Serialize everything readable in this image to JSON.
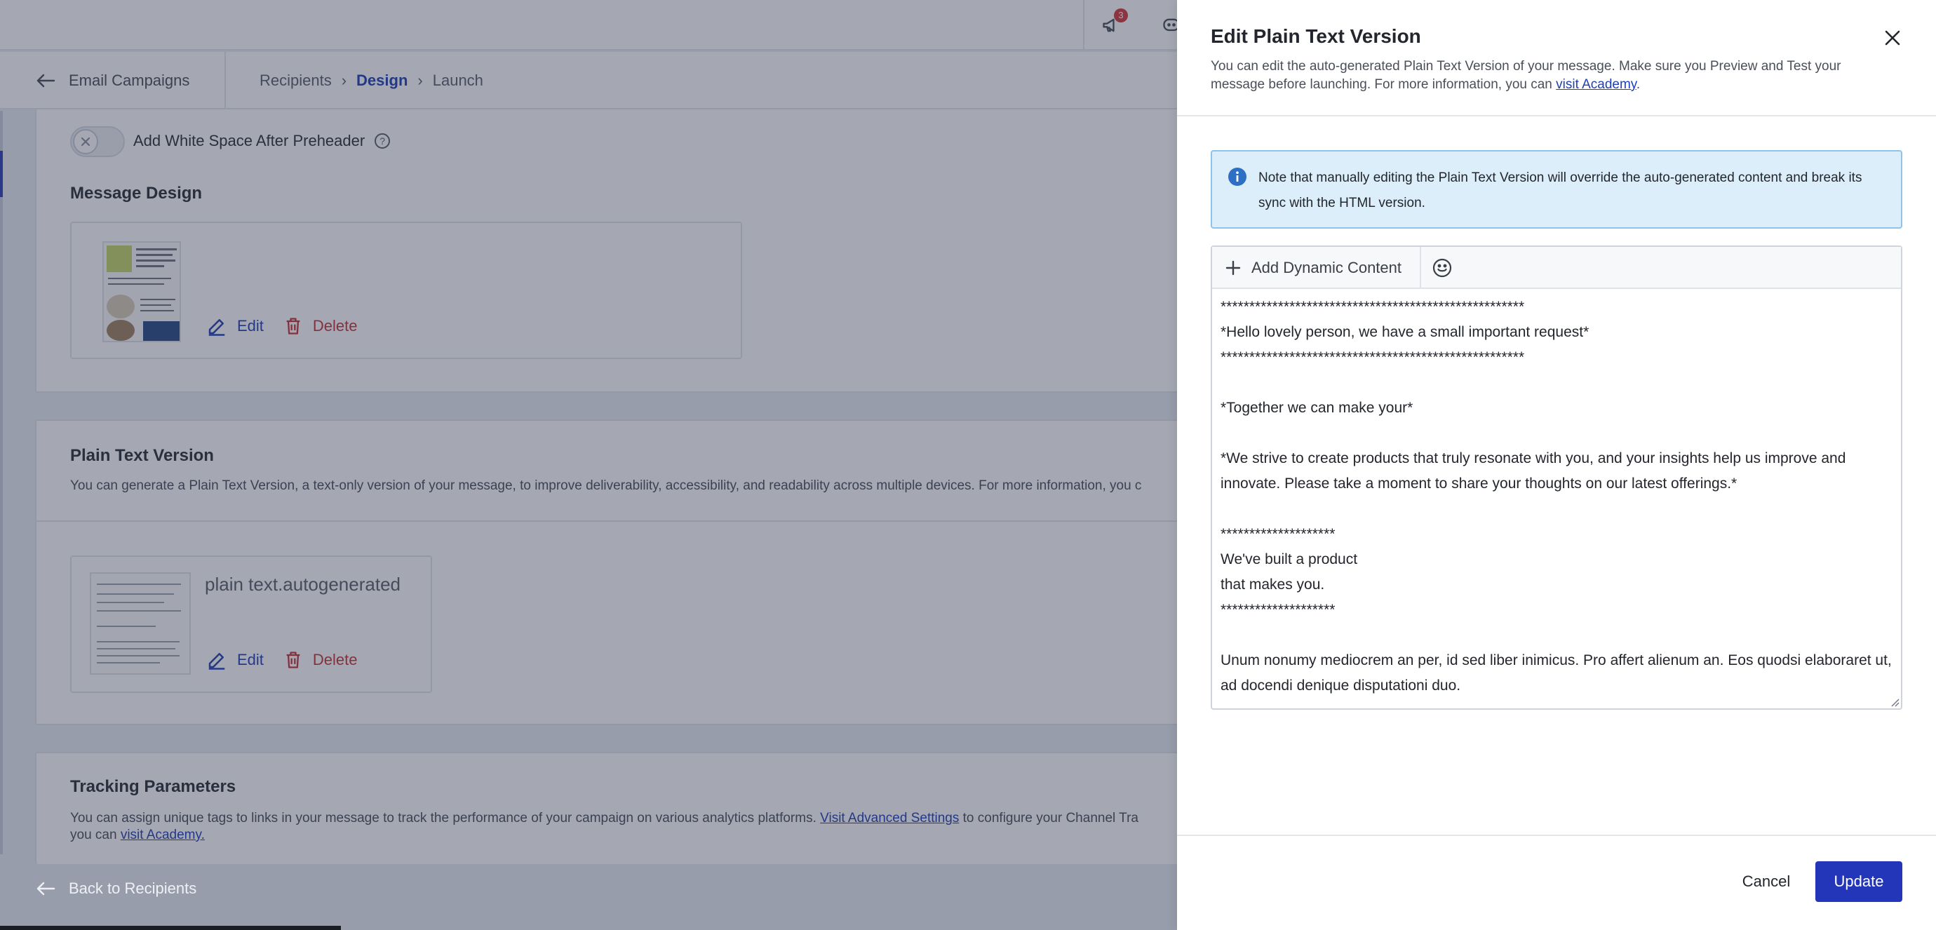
{
  "topbar": {
    "notification_count": "3"
  },
  "subnav": {
    "back_label": "Email Campaigns",
    "breadcrumbs": [
      {
        "label": "Recipients",
        "active": false
      },
      {
        "label": "Design",
        "active": true
      },
      {
        "label": "Launch",
        "active": false
      }
    ]
  },
  "design_section": {
    "whitespace_toggle_label": "Add White Space After Preheader",
    "whitespace_toggle_on": false,
    "title": "Message Design",
    "edit_label": "Edit",
    "delete_label": "Delete"
  },
  "plain_text_section": {
    "title": "Plain Text Version",
    "description": "You can generate a Plain Text Version, a text-only version of your message, to improve deliverability, accessibility, and readability across multiple devices. For more information, you c",
    "file_name": "plain text.autogenerated",
    "edit_label": "Edit",
    "delete_label": "Delete"
  },
  "tracking_section": {
    "title": "Tracking Parameters",
    "description_before": "You can assign unique tags to links in your message to track the performance of your campaign on various analytics platforms. ",
    "advanced_link": "Visit Advanced Settings",
    "description_after": " to configure your Channel Tra",
    "description_line2_before": "you can ",
    "academy_link": "visit Academy."
  },
  "footer": {
    "back_label": "Back to Recipients"
  },
  "panel": {
    "title": "Edit Plain Text Version",
    "description_before": "You can edit the auto-generated Plain Text Version of your message. Make sure you Preview and Test your message before launching. For more information, you can ",
    "description_link": "visit Academy",
    "description_after": ".",
    "info_text": "Note that manually editing the Plain Text Version will override the auto-generated content and break its sync with the HTML version.",
    "add_dynamic_content_label": "Add Dynamic Content",
    "editor_lines": [
      "*****************************************************",
      "*Hello lovely person, we have a small important request*",
      "*****************************************************",
      "",
      "*Together we can make your*",
      "",
      "*We strive to create products that truly resonate with you, and your insights help us improve and innovate. Please take a moment to share your thoughts on our latest offerings.*",
      "",
      "********************",
      "We've built a product",
      "that makes you.",
      "********************",
      "",
      "Unum nonumy mediocrem an per, id sed liber inimicus. Pro affert alienum an. Eos quodsi elaboraret ut, ad docendi denique disputationi duo."
    ],
    "cancel_label": "Cancel",
    "update_label": "Update"
  },
  "colors": {
    "accent": "#2335b8",
    "link": "#1f3fb3",
    "danger": "#c43535",
    "info_bg": "#dbeefa",
    "info_border": "#8fc3ea",
    "badge": "#d23a3a"
  },
  "icons": [
    "megaphone-icon",
    "chat-icon",
    "arrow-left-icon",
    "chevron-right-icon",
    "close-icon",
    "help-icon",
    "pencil-icon",
    "trash-icon",
    "info-icon",
    "plus-icon",
    "emoji-icon",
    "resize-handle-icon"
  ]
}
